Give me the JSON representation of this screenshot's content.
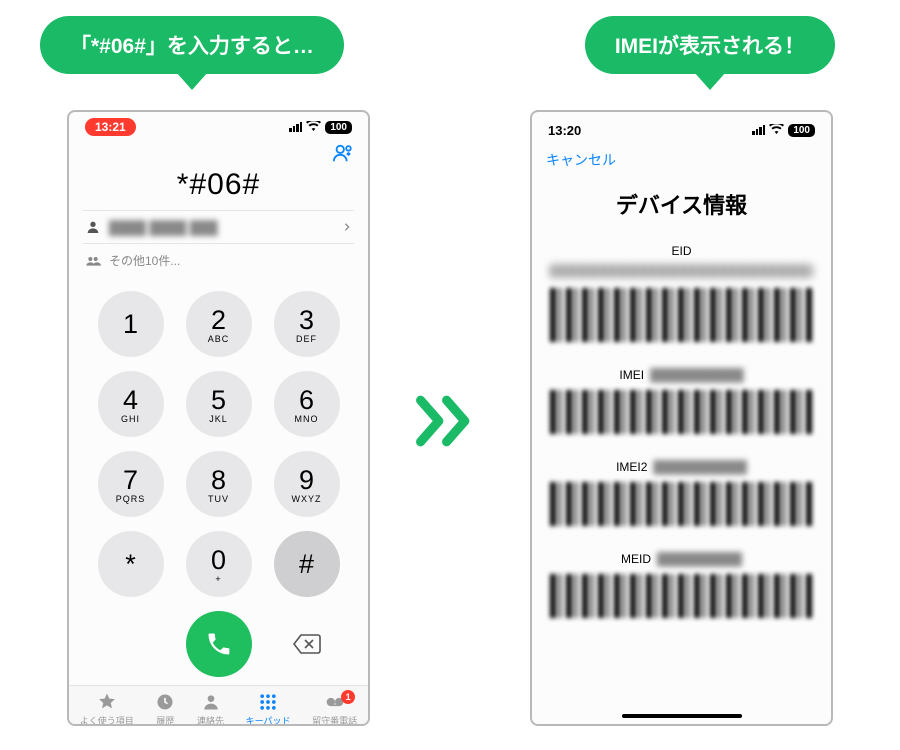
{
  "bubbles": {
    "left": "「*#06#」を入力すると…",
    "right": "IMEIが表示される！"
  },
  "left_screen": {
    "status": {
      "time": "13:21",
      "battery": "100"
    },
    "typed": "*#06#",
    "suggestion_more": "その他10件...",
    "keys": [
      {
        "d": "1",
        "s": ""
      },
      {
        "d": "2",
        "s": "ABC"
      },
      {
        "d": "3",
        "s": "DEF"
      },
      {
        "d": "4",
        "s": "GHI"
      },
      {
        "d": "5",
        "s": "JKL"
      },
      {
        "d": "6",
        "s": "MNO"
      },
      {
        "d": "7",
        "s": "PQRS"
      },
      {
        "d": "8",
        "s": "TUV"
      },
      {
        "d": "9",
        "s": "WXYZ"
      },
      {
        "d": "*",
        "s": ""
      },
      {
        "d": "0",
        "s": "+"
      },
      {
        "d": "#",
        "s": ""
      }
    ],
    "tabs": {
      "favorites": "よく使う項目",
      "recents": "履歴",
      "contacts": "連絡先",
      "keypad": "キーパッド",
      "voicemail": "留守番電話",
      "voicemail_badge": "1"
    }
  },
  "right_screen": {
    "status": {
      "time": "13:20",
      "battery": "100"
    },
    "cancel": "キャンセル",
    "title": "デバイス情報",
    "fields": {
      "eid": "EID",
      "imei": "IMEI",
      "imei2": "IMEI2",
      "meid": "MEID"
    }
  }
}
